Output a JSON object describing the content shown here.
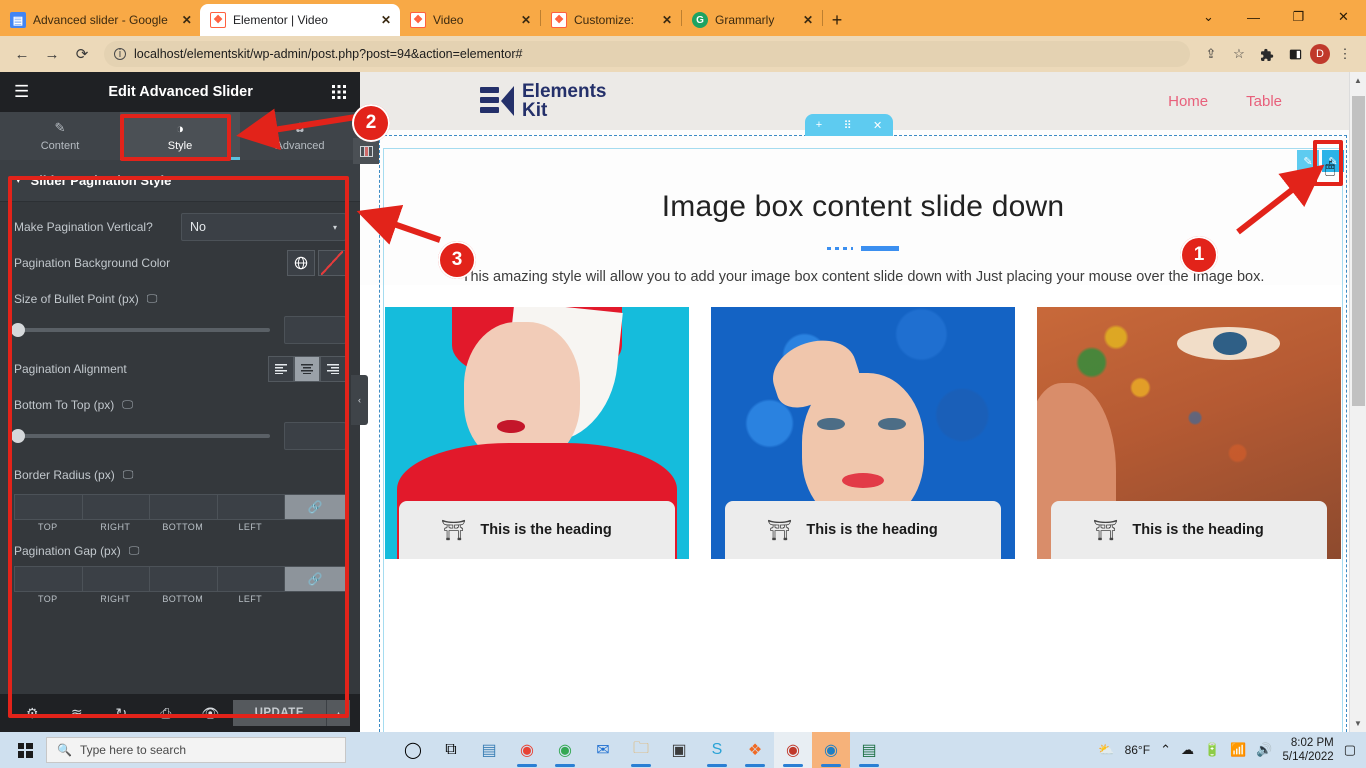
{
  "browser": {
    "tabs": [
      {
        "title": "Advanced slider - Google Do",
        "favicon": "google-docs-icon",
        "close": "✕",
        "active": false
      },
      {
        "title": "Elementor | Video",
        "favicon": "elementskit-icon",
        "close": "✕",
        "active": true
      },
      {
        "title": "Video",
        "favicon": "elementskit-icon",
        "close": "✕",
        "active": false
      },
      {
        "title": "Customize:",
        "favicon": "elementskit-icon",
        "close": "✕",
        "active": false
      },
      {
        "title": "Grammarly",
        "favicon": "grammarly-icon",
        "close": "✕",
        "active": false
      }
    ],
    "new_tab": "+",
    "window_controls": {
      "list": "⌄",
      "minimize": "—",
      "maximize": "❐",
      "close": "✕"
    },
    "nav": {
      "back": "←",
      "forward": "→",
      "reload": "⟳"
    },
    "address": {
      "value": "localhost/elementskit/wp-admin/post.php?post=94&action=elementor#",
      "info": "i"
    },
    "toolbar_icons": {
      "share": "⇪",
      "bookmark": "☆",
      "extensions": "🧩",
      "sidepanel": "▯",
      "profile": "D",
      "menu": "⋮"
    }
  },
  "panel": {
    "header": {
      "menu_icon": "hamburger-icon",
      "title": "Edit Advanced Slider",
      "grid_icon": "apps-grid-icon"
    },
    "tabs": [
      {
        "label": "Content",
        "icon": "pencil-icon",
        "active": false
      },
      {
        "label": "Style",
        "icon": "contrast-icon",
        "active": true
      },
      {
        "label": "Advanced",
        "icon": "gear-icon",
        "active": false
      }
    ],
    "section": {
      "caret": "▾",
      "title": "Slider Pagination Style"
    },
    "controls": {
      "make_vertical": {
        "label": "Make Pagination Vertical?",
        "value": "No",
        "caret": "▾"
      },
      "bg_color": {
        "label": "Pagination Background Color",
        "globe": "🌐",
        "swatch": "none"
      },
      "bullet_size": {
        "label": "Size of Bullet Point (px)",
        "responsive": "desktop-icon",
        "value": ""
      },
      "alignment": {
        "label": "Pagination Alignment",
        "options": [
          "left",
          "center",
          "right"
        ],
        "selected": "center"
      },
      "bottom_to_top": {
        "label": "Bottom To Top (px)",
        "responsive": "desktop-icon",
        "value": ""
      },
      "border_radius": {
        "label": "Border Radius (px)",
        "responsive": "desktop-icon",
        "fields": [
          "",
          "",
          "",
          ""
        ],
        "field_labels": [
          "TOP",
          "RIGHT",
          "BOTTOM",
          "LEFT"
        ],
        "link_icon": "link-icon"
      },
      "pagination_gap": {
        "label": "Pagination Gap (px)",
        "responsive": "desktop-icon",
        "fields": [
          "",
          "",
          "",
          ""
        ],
        "field_labels": [
          "TOP",
          "RIGHT",
          "BOTTOM",
          "LEFT"
        ],
        "link_icon": "link-icon"
      }
    },
    "footer": {
      "icons": [
        "settings-gear-icon",
        "navigator-layers-icon",
        "history-icon",
        "responsive-icon",
        "preview-eye-icon"
      ],
      "update_label": "UPDATE",
      "update_caret": "▴"
    },
    "collapse_arrow": "‹",
    "column_toggle": "columns-icon"
  },
  "canvas": {
    "logo": {
      "text_line1": "Elements",
      "text_line2": "Kit"
    },
    "nav_links": [
      "Home",
      "Table"
    ],
    "section_toolbar": {
      "add": "+",
      "drag": "⠿",
      "remove": "✕"
    },
    "edit_handles": [
      "pencil-icon",
      "pencil-icon"
    ],
    "hero": {
      "title": "Image box content slide down",
      "description": "This amazing style will allow you to add your image box content slide down with Just placing your mouse over the Image box.",
      "accent_color": "#3b8ff0"
    },
    "cards": [
      {
        "image": "woman-red-sweater-cyan-background",
        "icon": "podium-icon",
        "heading": "This is the heading"
      },
      {
        "image": "woman-blue-afro-wig",
        "icon": "podium-icon",
        "heading": "This is the heading"
      },
      {
        "image": "woman-colorful-face-paint",
        "icon": "podium-icon",
        "heading": "This is the heading"
      }
    ]
  },
  "scrollbar": {
    "up": "▲",
    "down": "▼"
  },
  "annotations": [
    {
      "number": "1",
      "target": "edit-handle-top-right"
    },
    {
      "number": "2",
      "target": "style-tab"
    },
    {
      "number": "3",
      "target": "slider-pagination-style-section"
    }
  ],
  "taskbar": {
    "start": "windows-logo-icon",
    "search_placeholder": "Type here to search",
    "search_icon": "search-icon",
    "pinned": [
      "cortana-icon",
      "task-view-icon",
      "file-explorer-legacy-icon",
      "chrome-icon",
      "chrome-profile-icon",
      "mail-icon",
      "folder-icon",
      "notepad-icon",
      "skype-icon",
      "xampp-icon",
      "chrome-dev-icon",
      "edge-icon",
      "excel-icon"
    ],
    "weather": {
      "icon": "partly-sunny-icon",
      "temp": "86°F"
    },
    "tray": [
      "chevron-up-icon",
      "onedrive-icon",
      "battery-icon",
      "wifi-icon",
      "volume-icon"
    ],
    "clock": {
      "time": "8:02 PM",
      "date": "5/14/2022"
    },
    "notifications": "notification-icon"
  }
}
